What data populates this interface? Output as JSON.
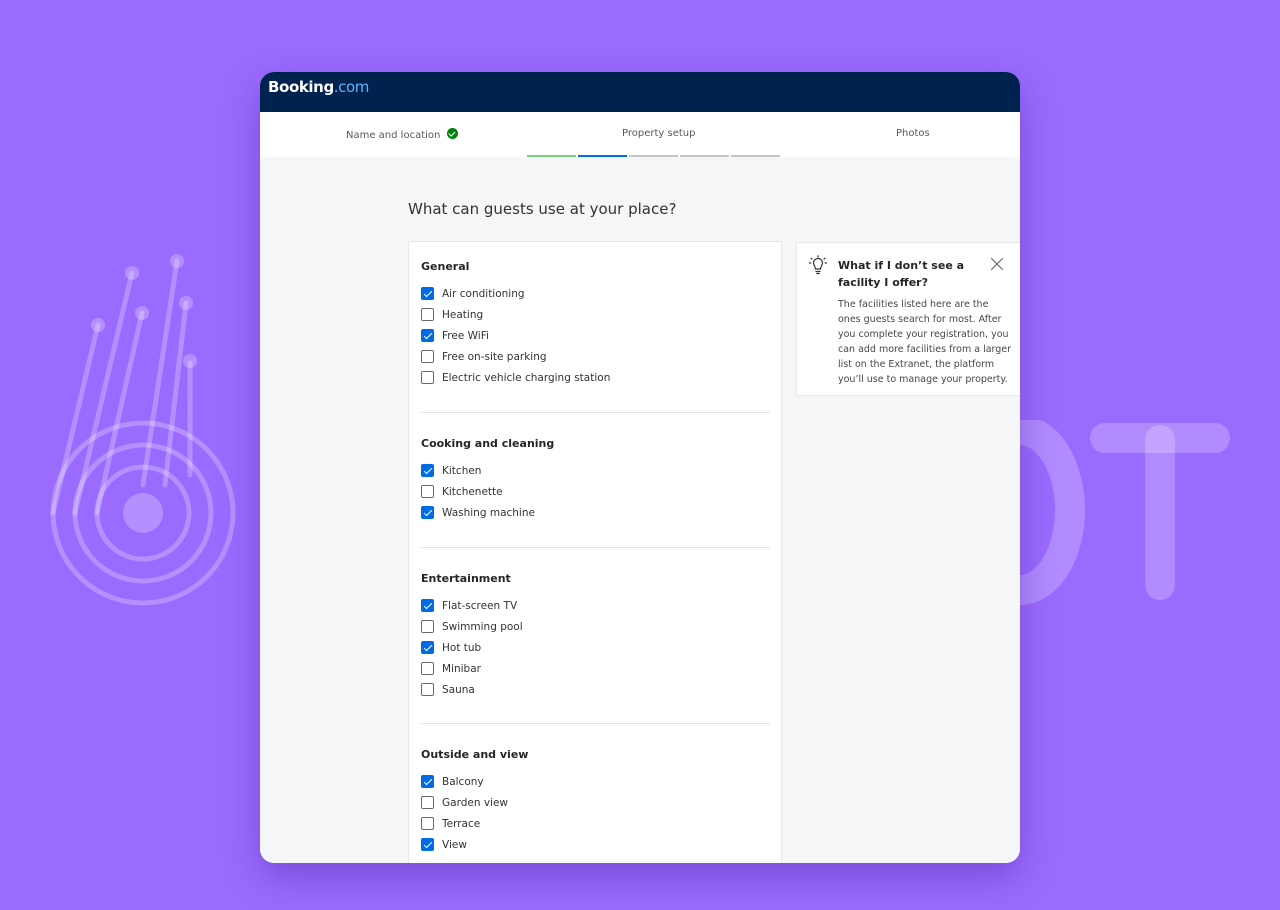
{
  "brand": {
    "name": "Booking",
    "suffix": ".com"
  },
  "steps": [
    {
      "label": "Name and location",
      "status": "completed"
    },
    {
      "label": "Property setup",
      "status": "active"
    },
    {
      "label": "Photos",
      "status": "upcoming"
    }
  ],
  "progress": {
    "segments": [
      "done",
      "active",
      "upcoming",
      "upcoming",
      "upcoming"
    ]
  },
  "page": {
    "title": "What can guests use at your place?"
  },
  "sections": [
    {
      "title": "General",
      "options": [
        {
          "label": "Air conditioning",
          "checked": true
        },
        {
          "label": "Heating",
          "checked": false
        },
        {
          "label": "Free WiFi",
          "checked": true
        },
        {
          "label": "Free on-site parking",
          "checked": false
        },
        {
          "label": "Electric vehicle charging station",
          "checked": false
        }
      ]
    },
    {
      "title": "Cooking and cleaning",
      "options": [
        {
          "label": "Kitchen",
          "checked": true
        },
        {
          "label": "Kitchenette",
          "checked": false
        },
        {
          "label": "Washing machine",
          "checked": true
        }
      ]
    },
    {
      "title": "Entertainment",
      "options": [
        {
          "label": "Flat-screen TV",
          "checked": true
        },
        {
          "label": "Swimming pool",
          "checked": false
        },
        {
          "label": "Hot tub",
          "checked": true
        },
        {
          "label": "Minibar",
          "checked": false
        },
        {
          "label": "Sauna",
          "checked": false
        }
      ]
    },
    {
      "title": "Outside and view",
      "options": [
        {
          "label": "Balcony",
          "checked": true
        },
        {
          "label": "Garden view",
          "checked": false
        },
        {
          "label": "Terrace",
          "checked": false
        },
        {
          "label": "View",
          "checked": true
        }
      ]
    }
  ],
  "tip": {
    "title": "What if I don’t see a facility I offer?",
    "body": "The facilities listed here are the ones guests search for most. After you complete your registration, you can add more facilities from a larger list on the Extranet, the platform you’ll use to manage your property.",
    "icon": "lightbulb-icon",
    "close_icon": "close-icon"
  },
  "colors": {
    "background": "#9b6bff",
    "header": "#00224f",
    "accent": "#006ce4",
    "success": "#008009",
    "progress_done": "#79d17f"
  }
}
